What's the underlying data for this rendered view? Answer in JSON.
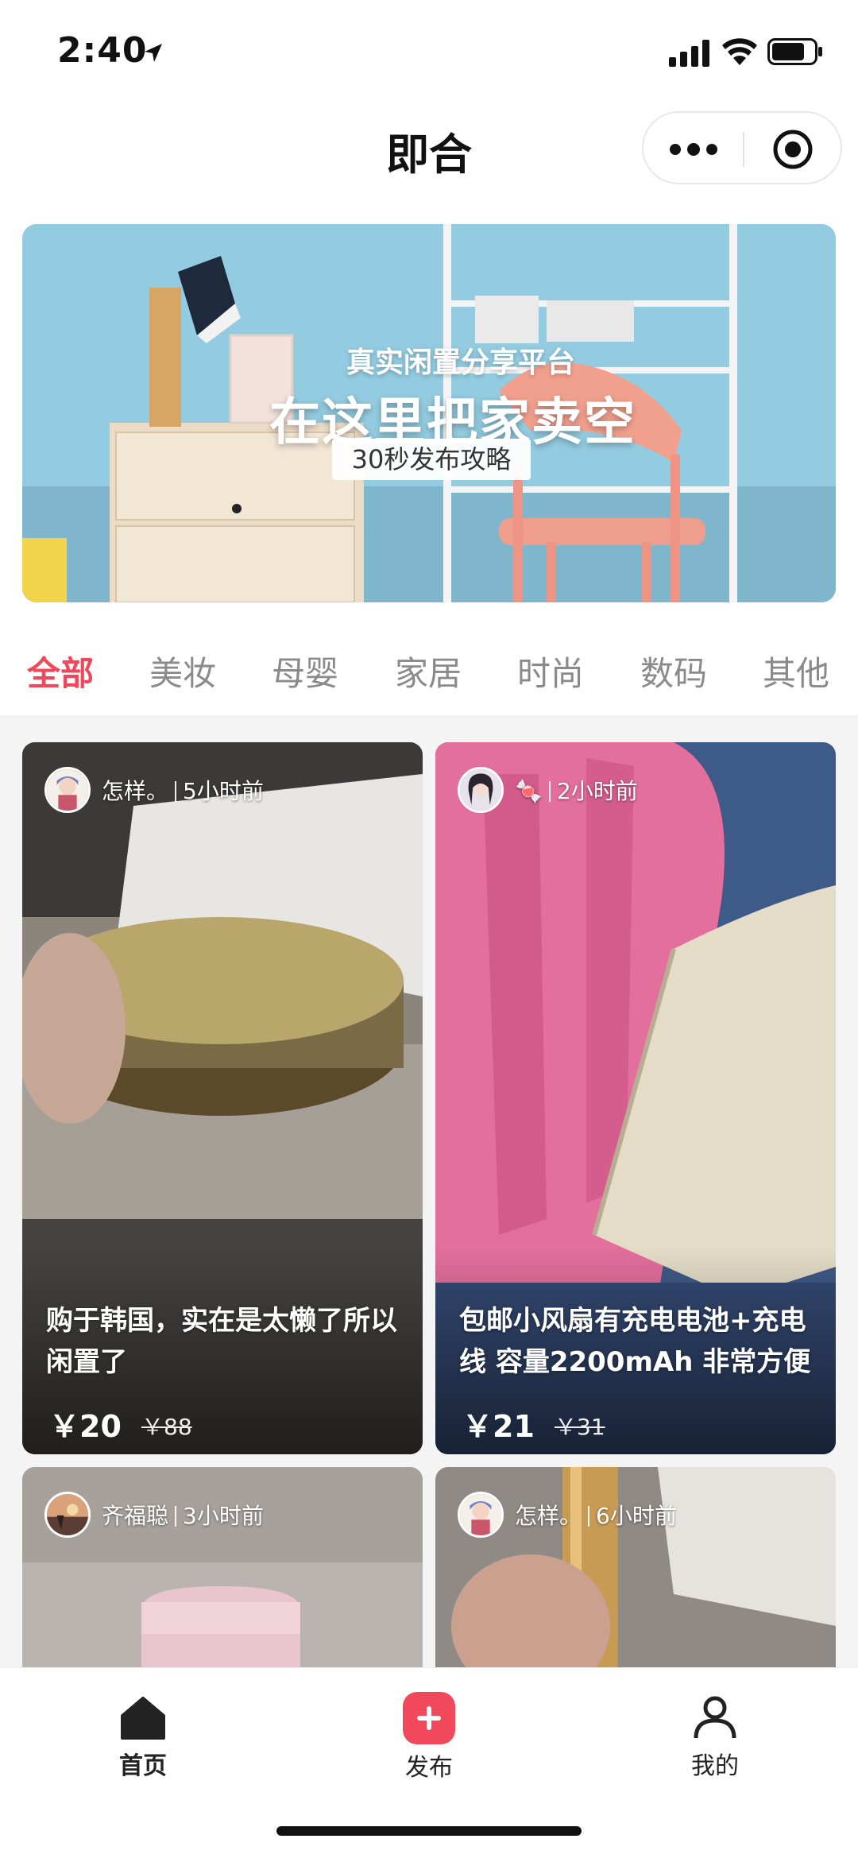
{
  "status_bar": {
    "time": "2:40"
  },
  "nav": {
    "title": "即合"
  },
  "banner": {
    "subtitle": "真实闲置分享平台",
    "headline": "在这里把家卖空",
    "button": "30秒发布攻略"
  },
  "tabs": [
    "全部",
    "美妆",
    "母婴",
    "家居",
    "时尚",
    "数码",
    "其他"
  ],
  "active_tab": "全部",
  "accent_color": "#f0475a",
  "feed": [
    {
      "user": "怎样。",
      "time": "5小时前",
      "title": "购于韩国，实在是太懒了所以闲置了",
      "price": "￥20",
      "original_price": "￥88"
    },
    {
      "user": "🍬",
      "time": "2小时前",
      "title": "包邮小风扇有充电电池+充电线 容量2200mAh 非常方便",
      "price": "￥21",
      "original_price": "￥31"
    },
    {
      "user": "齐福聪",
      "time": "3小时前"
    },
    {
      "user": "怎样。",
      "time": "6小时前"
    }
  ],
  "tabbar": {
    "home": "首页",
    "publish": "发布",
    "mine": "我的"
  }
}
